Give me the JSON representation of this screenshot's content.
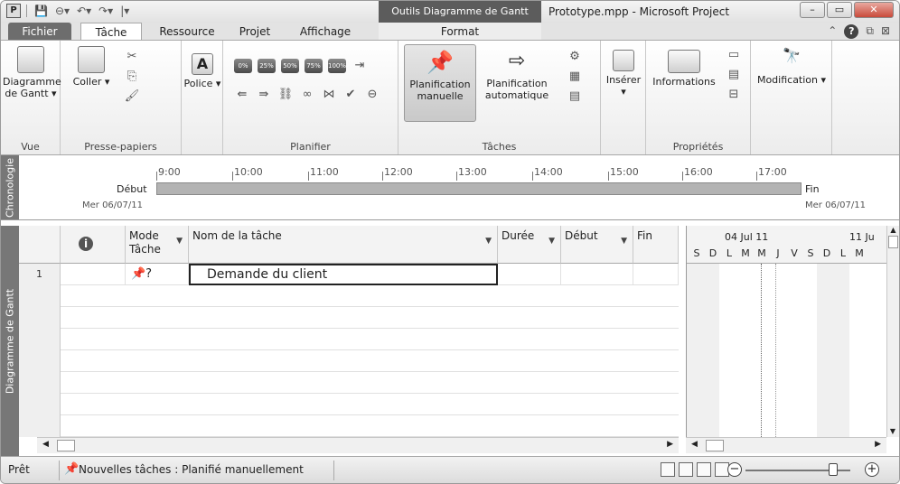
{
  "title_bar": {
    "context_title": "Outils Diagramme de Gantt",
    "window_title": "Prototype.mpp - Microsoft Project",
    "minimize": "–",
    "maximize": "▭",
    "close": "✕"
  },
  "tabs": {
    "file": "Fichier",
    "task": "Tâche",
    "resource": "Ressource",
    "project": "Projet",
    "view": "Affichage",
    "format": "Format"
  },
  "ribbon": {
    "gantt_chart": "Diagramme de Gantt ▾",
    "group_view": "Vue",
    "paste": "Coller ▾",
    "group_clipboard": "Presse-papiers",
    "font": "Police ▾",
    "group_schedule": "Planifier",
    "manual_schedule": "Planification manuelle",
    "auto_schedule": "Planification automatique",
    "group_tasks": "Tâches",
    "insert": "Insérer ▾",
    "information": "Informations",
    "group_properties": "Propriétés",
    "modify": "Modification ▾",
    "pct_0": "0%",
    "pct_25": "25%",
    "pct_50": "50%",
    "pct_75": "75%",
    "pct_100": "100%"
  },
  "timeline": {
    "label": "Chronologie",
    "ticks": [
      "9:00",
      "10:00",
      "11:00",
      "12:00",
      "13:00",
      "14:00",
      "15:00",
      "16:00",
      "17:00"
    ],
    "start_label": "Début",
    "start_date": "Mer 06/07/11",
    "end_label": "Fin",
    "end_date": "Mer 06/07/11"
  },
  "gantt": {
    "side_label": "Diagramme de Gantt",
    "columns": {
      "mode": "Mode Tâche",
      "name": "Nom de la tâche",
      "duration": "Durée",
      "start": "Début",
      "finish": "Fin"
    },
    "rows": [
      {
        "id": "1",
        "mode_icon": "manual-pin-question-icon",
        "name": "Demande du client",
        "duration": "",
        "start": "",
        "finish": ""
      }
    ],
    "chart_weeks": [
      "04 Jul 11",
      "11 Ju"
    ],
    "chart_days": [
      "S",
      "D",
      "L",
      "M",
      "M",
      "J",
      "V",
      "S",
      "D",
      "L",
      "M"
    ]
  },
  "status_bar": {
    "ready": "Prêt",
    "new_tasks": "Nouvelles tâches : Planifié manuellement"
  }
}
